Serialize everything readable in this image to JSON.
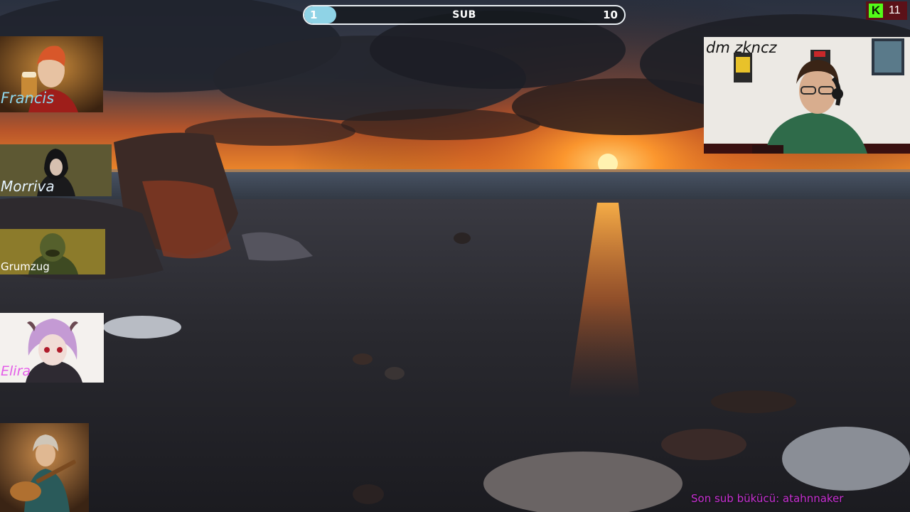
{
  "sub_goal": {
    "current": "1",
    "label": "SUB",
    "target": "10",
    "progress_fraction": 0.1,
    "fill_color": "#8fd3e6"
  },
  "viewer_counter": {
    "icon": "kick-logo-icon",
    "logo_letter": "K",
    "value": "11",
    "logo_color": "#53fc18"
  },
  "players": [
    {
      "name": "Francis",
      "name_color": "#8fd6ea"
    },
    {
      "name": "Morriva",
      "name_color": "#e6f4ff"
    },
    {
      "name": "Grumzug",
      "name_color": "#ffffff"
    },
    {
      "name": "Elira",
      "name_color": "#e45de8"
    },
    {
      "name": "",
      "name_color": "#ffffff"
    }
  ],
  "webcam": {
    "label": "dm zkncz"
  },
  "last_sub": {
    "text": "Son sub bükücü: atahnnaker",
    "color": "#c72fd2"
  }
}
